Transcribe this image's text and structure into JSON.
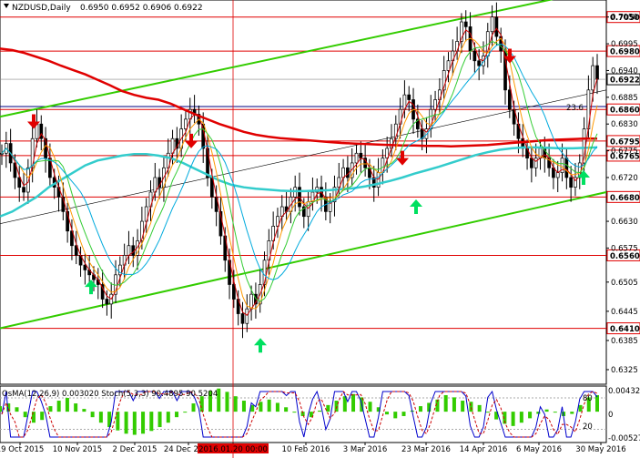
{
  "header": {
    "symbol": "NZDUSD,Daily",
    "ohlc": "0.6950 0.6952 0.6906 0.6922"
  },
  "oscillator": {
    "title": "OsMA(12,26,9) 0.003020  Stoch(5,3,3) 90.4895 90.5204",
    "scale_top": "0.00432",
    "scale_bottom": "-0.00527",
    "stoch_80": "80",
    "stoch_20": "20",
    "zero": "0"
  },
  "fib_label": "23.6",
  "colors": {
    "bg": "#ffffff",
    "candle": "#000000",
    "ema200": "#e00000",
    "ema144": "#33cccc",
    "channel": "#33cc00",
    "level_line": "#e00000",
    "blue_line": "#000080",
    "osma_bar": "#33cc00",
    "stoch_main": "#0000cc",
    "stoch_signal": "#cc0000",
    "up_arrow": "#00e060",
    "down_arrow": "#e00000"
  },
  "chart_data": {
    "type": "candlestick",
    "title": "NZDUSD,Daily",
    "y_ticks": [
      "0.7050",
      "0.6995",
      "0.6940",
      "0.6885",
      "0.6830",
      "0.6775",
      "0.6720",
      "0.6630",
      "0.6575",
      "0.6505",
      "0.6445",
      "0.6385",
      "0.6325"
    ],
    "x_ticks": [
      "19 Oct 2015",
      "10 Nov 2015",
      "2 Dec 2015",
      "24 Dec 2015",
      "2016.01.20 00:00",
      "10 Feb 2016",
      "3 Mar 2016",
      "23 Mar 2016",
      "14 Apr 2016",
      "6 May 2016",
      "30 May 2016"
    ],
    "levels": [
      {
        "label": "0.7050",
        "value": 0.705,
        "style": "red"
      },
      {
        "label": "0.6980",
        "value": 0.698,
        "style": "red"
      },
      {
        "label": "0.6922",
        "value": 0.6922,
        "style": "price"
      },
      {
        "label": "0.6860",
        "value": 0.686,
        "style": "red"
      },
      {
        "label": "0.6795",
        "value": 0.6795,
        "style": "red"
      },
      {
        "label": "0.6765",
        "value": 0.6765,
        "style": "red"
      },
      {
        "label": "0.6680",
        "value": 0.668,
        "style": "red"
      },
      {
        "label": "0.6560",
        "value": 0.656,
        "style": "red"
      },
      {
        "label": "0.6410",
        "value": 0.641,
        "style": "red"
      }
    ],
    "closes": [
      0.677,
      0.679,
      0.675,
      0.672,
      0.67,
      0.669,
      0.674,
      0.68,
      0.683,
      0.68,
      0.676,
      0.672,
      0.67,
      0.668,
      0.665,
      0.661,
      0.658,
      0.656,
      0.654,
      0.653,
      0.652,
      0.651,
      0.65,
      0.647,
      0.646,
      0.648,
      0.652,
      0.654,
      0.656,
      0.658,
      0.656,
      0.659,
      0.663,
      0.666,
      0.669,
      0.672,
      0.67,
      0.674,
      0.677,
      0.68,
      0.678,
      0.682,
      0.684,
      0.686,
      0.685,
      0.683,
      0.678,
      0.672,
      0.668,
      0.665,
      0.66,
      0.655,
      0.65,
      0.647,
      0.644,
      0.642,
      0.645,
      0.648,
      0.646,
      0.65,
      0.655,
      0.659,
      0.662,
      0.664,
      0.666,
      0.665,
      0.668,
      0.67,
      0.666,
      0.664,
      0.667,
      0.669,
      0.67,
      0.668,
      0.665,
      0.667,
      0.67,
      0.672,
      0.674,
      0.672,
      0.675,
      0.677,
      0.676,
      0.674,
      0.672,
      0.67,
      0.673,
      0.676,
      0.678,
      0.68,
      0.683,
      0.686,
      0.689,
      0.688,
      0.684,
      0.682,
      0.68,
      0.682,
      0.686,
      0.688,
      0.69,
      0.694,
      0.696,
      0.698,
      0.7,
      0.704,
      0.703,
      0.698,
      0.696,
      0.695,
      0.697,
      0.702,
      0.705,
      0.701,
      0.698,
      0.69,
      0.686,
      0.683,
      0.68,
      0.678,
      0.676,
      0.674,
      0.676,
      0.678,
      0.676,
      0.674,
      0.672,
      0.673,
      0.676,
      0.672,
      0.67,
      0.672,
      0.675,
      0.682,
      0.69,
      0.695,
      0.6922
    ],
    "ema200": [
      0.6985,
      0.6982,
      0.6976,
      0.6968,
      0.696,
      0.695,
      0.6941,
      0.6932,
      0.6921,
      0.691,
      0.6898,
      0.689,
      0.6884,
      0.688,
      0.6872,
      0.6861,
      0.685,
      0.684,
      0.683,
      0.6822,
      0.6814,
      0.6808,
      0.6804,
      0.6801,
      0.6799,
      0.6797,
      0.6795,
      0.6793,
      0.6791,
      0.679,
      0.6789,
      0.6788,
      0.6787,
      0.6786,
      0.6786,
      0.6785,
      0.6785,
      0.6784,
      0.6785,
      0.6786,
      0.6787,
      0.6789,
      0.6791,
      0.6793,
      0.6795,
      0.6797,
      0.6798,
      0.6799,
      0.68,
      0.68
    ],
    "ema144": [
      0.664,
      0.665,
      0.6665,
      0.668,
      0.67,
      0.6715,
      0.673,
      0.6745,
      0.6755,
      0.676,
      0.6765,
      0.6768,
      0.6768,
      0.6765,
      0.676,
      0.675,
      0.6738,
      0.6726,
      0.6714,
      0.6705,
      0.67,
      0.6697,
      0.6695,
      0.6693,
      0.6692,
      0.6692,
      0.6693,
      0.6694,
      0.6696,
      0.6698,
      0.6702,
      0.6707,
      0.6713,
      0.672,
      0.6728,
      0.6735,
      0.6742,
      0.675,
      0.6758,
      0.6766,
      0.6772,
      0.6777,
      0.678,
      0.6782,
      0.6782,
      0.6781,
      0.678,
      0.678,
      0.6781,
      0.6782
    ],
    "osma": [
      0.001,
      0.0015,
      0.0008,
      -0.001,
      -0.002,
      -0.0015,
      0.001,
      0.002,
      0.0025,
      0.0015,
      0.0005,
      -0.001,
      -0.002,
      -0.0028,
      -0.0034,
      -0.004,
      -0.0042,
      -0.004,
      -0.0035,
      -0.0028,
      -0.002,
      -0.001,
      0.0,
      0.0015,
      0.0028,
      0.0038,
      0.0042,
      0.0036,
      0.0028,
      0.002,
      0.0012,
      0.0018,
      0.0022,
      0.0016,
      0.0008,
      0.0,
      -0.0008,
      -0.001,
      0.0002,
      0.0012,
      0.002,
      0.0028,
      0.0032,
      0.0026,
      0.0018,
      0.0008,
      -0.0005,
      -0.0012,
      -0.0008,
      0.0002,
      0.001,
      0.0016,
      0.0022,
      0.003,
      0.0026,
      0.002,
      0.0018,
      0.0012,
      0.0,
      -0.0014,
      -0.0022,
      -0.0026,
      -0.002,
      -0.0012,
      -0.0004,
      0.0004,
      0.0,
      -0.0008,
      -0.0004,
      0.0012,
      0.0026,
      0.003
    ]
  }
}
